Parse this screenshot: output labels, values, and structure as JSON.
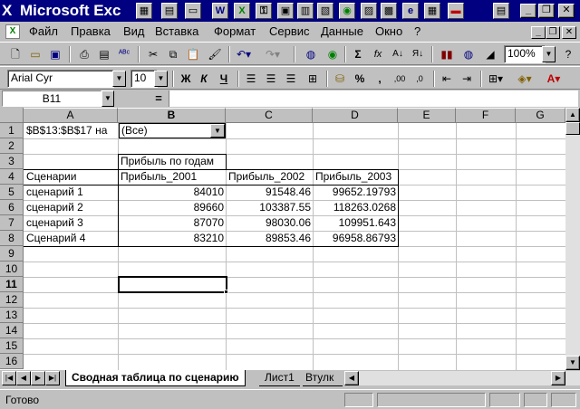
{
  "window": {
    "title": "Microsoft Exc",
    "minimize": "_",
    "restore": "❐",
    "close": "✕"
  },
  "menu": {
    "items": [
      "Файл",
      "Правка",
      "Вид",
      "Вставка",
      "Формат",
      "Сервис",
      "Данные",
      "Окно",
      "?"
    ],
    "doc_min": "_",
    "doc_restore": "❐",
    "doc_close": "✕"
  },
  "toolbar_standard": {
    "zoom": "100%",
    "sigma": "Σ",
    "fx": "fx"
  },
  "toolbar_format": {
    "font_name": "Arial Cyr",
    "font_size": "10",
    "bold": "Ж",
    "italic": "К",
    "underline": "Ч",
    "percent": "%",
    "comma": ",",
    "inc_dec": ",00",
    "dec_dec": ",0"
  },
  "formula_bar": {
    "name_box": "B11",
    "equals": "="
  },
  "columns": [
    "A",
    "B",
    "C",
    "D",
    "E",
    "F",
    "G"
  ],
  "rows": [
    "1",
    "2",
    "3",
    "4",
    "5",
    "6",
    "7",
    "8",
    "9",
    "10",
    "11",
    "12",
    "13",
    "14",
    "15",
    "16"
  ],
  "active": {
    "column": "B",
    "row": "11"
  },
  "cells": {
    "a1": "$B$13:$B$17 на",
    "b1": "(Все)",
    "b3": "Прибыль по годам",
    "a4": "Сценарии",
    "b4": "Прибыль_2001",
    "c4": "Прибыль_2002",
    "d4": "Прибыль_2003",
    "data": [
      {
        "name": "сценарий 1",
        "v2001": "84010",
        "v2002": "91548.46",
        "v2003": "99652.19793"
      },
      {
        "name": "сценарий 2",
        "v2001": "89660",
        "v2002": "103387.55",
        "v2003": "118263.0268"
      },
      {
        "name": "сценарий 3",
        "v2001": "87070",
        "v2002": "98030.06",
        "v2003": "109951.643"
      },
      {
        "name": "Сценарий 4",
        "v2001": "83210",
        "v2002": "89853.46",
        "v2003": "96958.86793"
      }
    ]
  },
  "sheet_tabs": [
    "Сводная таблица по сценарию",
    "Лист1",
    "Втулк"
  ],
  "status": {
    "text": "Готово"
  }
}
